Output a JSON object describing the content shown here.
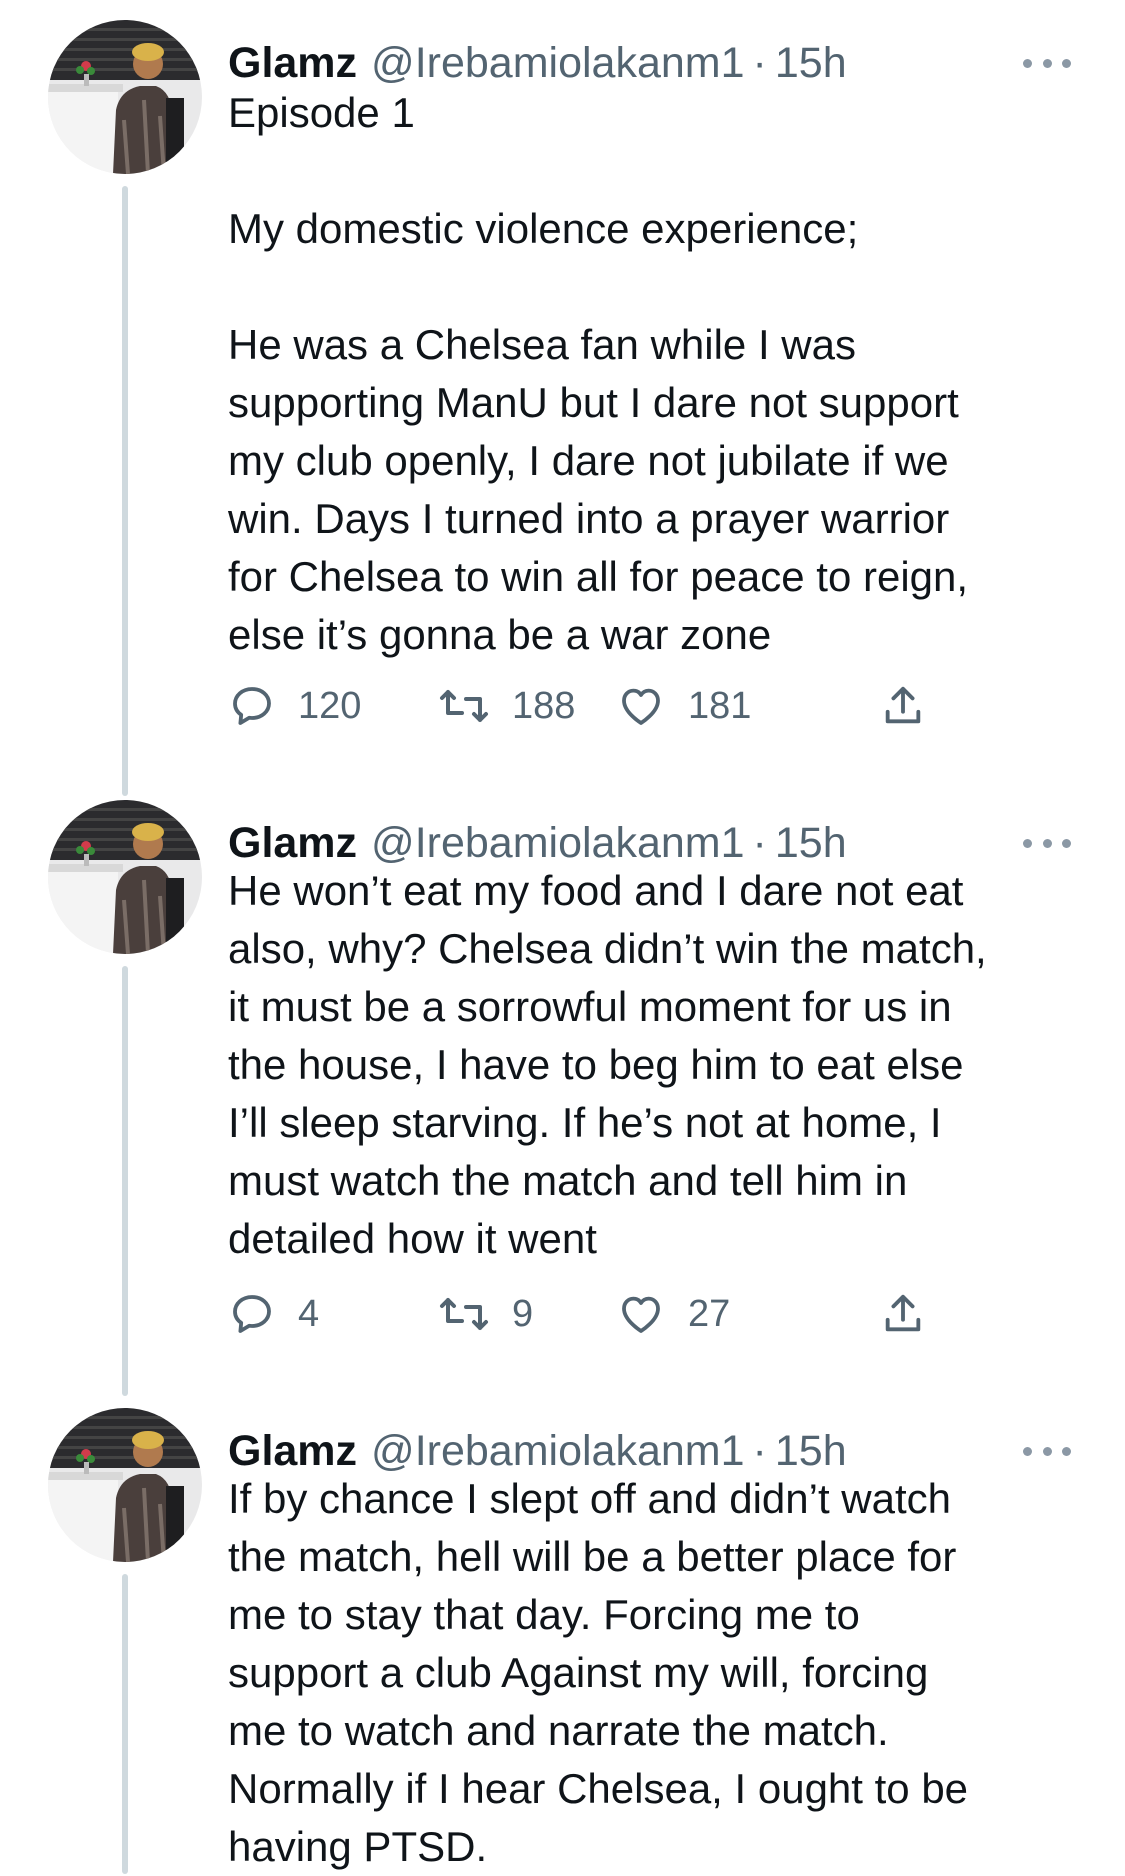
{
  "tweets": [
    {
      "name": "Glamz",
      "handle": "@Irebamiolakanm1",
      "separator": "·",
      "time": "15h",
      "text": "Episode 1\n\nMy domestic violence experience;\n\nHe was a Chelsea fan while I was\nsupporting ManU but I dare not support\nmy club openly, I dare not jubilate if we\nwin. Days I turned into a prayer warrior\nfor Chelsea to win all for peace to reign,\nelse it’s gonna be a war zone",
      "replies": "120",
      "retweets": "188",
      "likes": "181"
    },
    {
      "name": "Glamz",
      "handle": "@Irebamiolakanm1",
      "separator": "·",
      "time": "15h",
      "text": "He won’t eat my food and I dare not eat\nalso, why? Chelsea didn’t win the match,\nit must be a sorrowful moment for us in\nthe house, I have to beg him to eat else\nI’ll sleep starving. If he’s not at home, I\nmust watch the match and tell him in\ndetailed how it went",
      "replies": "4",
      "retweets": "9",
      "likes": "27"
    },
    {
      "name": "Glamz",
      "handle": "@Irebamiolakanm1",
      "separator": "·",
      "time": "15h",
      "text": "If by chance I slept off and didn’t watch\nthe match, hell will be a better place for\nme to stay that day. Forcing me to\nsupport a club Against my will, forcing\nme to watch and narrate the match.\nNormally if I hear Chelsea, I ought to be\nhaving PTSD."
    }
  ],
  "icons": {
    "reply": "reply-icon",
    "retweet": "retweet-icon",
    "like": "heart-icon",
    "share": "share-icon",
    "more": "more-icon"
  },
  "colors": {
    "text": "#0f1419",
    "secondary": "#536471",
    "thread_line": "#cfd9de"
  }
}
